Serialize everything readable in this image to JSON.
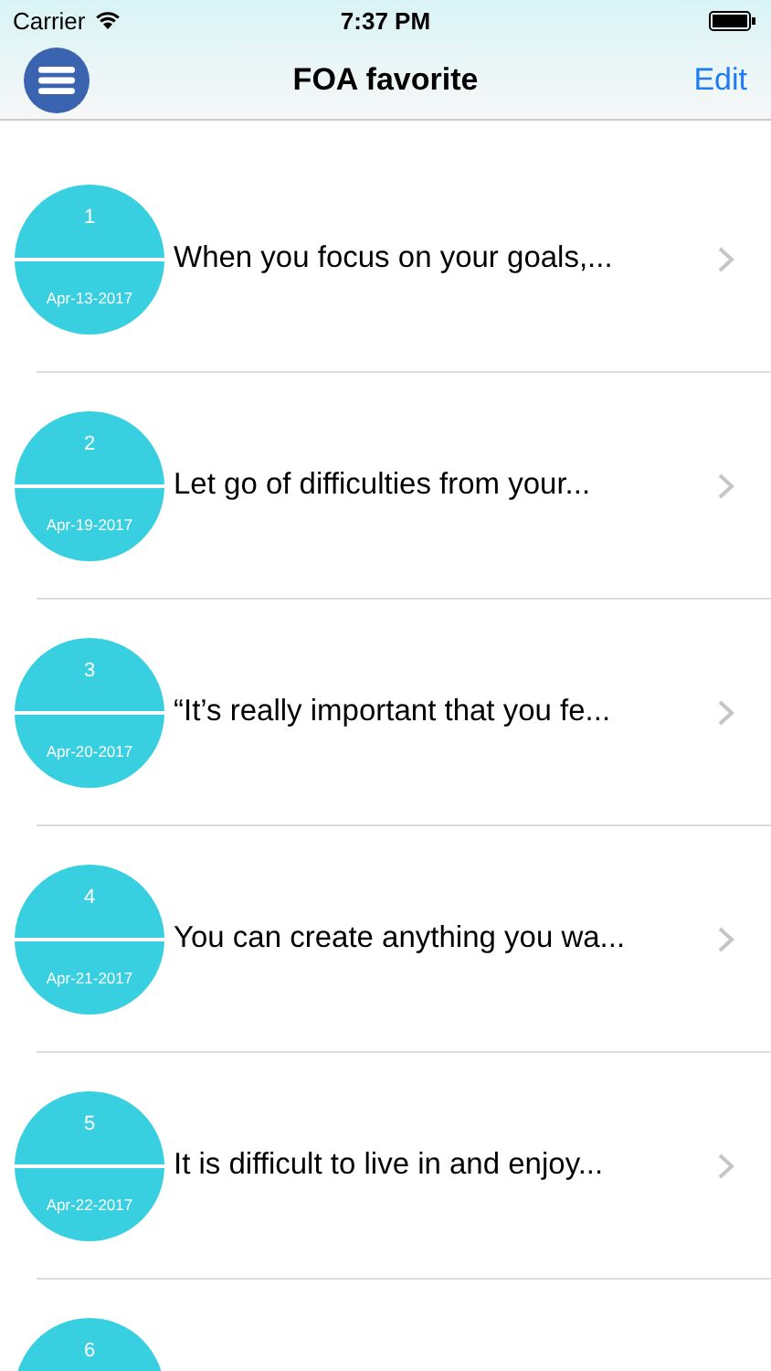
{
  "status_bar": {
    "carrier": "Carrier",
    "time": "7:37 PM"
  },
  "nav": {
    "title": "FOA favorite",
    "edit": "Edit"
  },
  "items": [
    {
      "number": "1",
      "date": "Apr-13-2017",
      "title": "When you focus on your goals,..."
    },
    {
      "number": "2",
      "date": "Apr-19-2017",
      "title": "Let go of difficulties from your..."
    },
    {
      "number": "3",
      "date": "Apr-20-2017",
      "title": "“It’s really important that you fe..."
    },
    {
      "number": "4",
      "date": "Apr-21-2017",
      "title": "You can create anything you wa..."
    },
    {
      "number": "5",
      "date": "Apr-22-2017",
      "title": "It is difficult to live in and enjoy..."
    },
    {
      "number": "6"
    }
  ]
}
